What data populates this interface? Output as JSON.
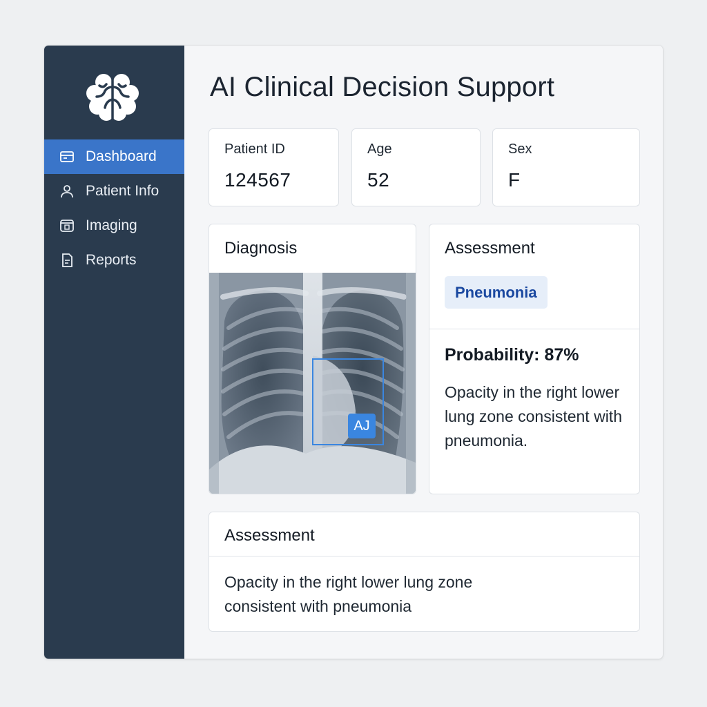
{
  "app": {
    "title": "AI Clinical Decision Support"
  },
  "sidebar": {
    "logo_icon": "brain-icon",
    "items": [
      {
        "label": "Dashboard",
        "icon": "dashboard-icon",
        "active": true
      },
      {
        "label": "Patient Info",
        "icon": "user-icon",
        "active": false
      },
      {
        "label": "Imaging",
        "icon": "imaging-icon",
        "active": false
      },
      {
        "label": "Reports",
        "icon": "document-icon",
        "active": false
      }
    ]
  },
  "patient": {
    "id_label": "Patient ID",
    "id_value": "124567",
    "age_label": "Age",
    "age_value": "52",
    "sex_label": "Sex",
    "sex_value": "F"
  },
  "diagnosis": {
    "title": "Diagnosis",
    "ai_badge": "AJ"
  },
  "assessment": {
    "title": "Assessment",
    "condition": "Pneumonia",
    "probability": "Probability: 87%",
    "description": "Opacity in the right lower lung zone consistent with pneumonia."
  },
  "bottom_assessment": {
    "title": "Assessment",
    "text": "Opacity in the right lower lung zone consistent with pneumonia"
  },
  "colors": {
    "sidebar_bg": "#2a3b4e",
    "accent": "#3a75c9",
    "highlight_box": "#3a86e0",
    "pill_bg": "#e6eef9",
    "pill_text": "#1a48a0"
  }
}
